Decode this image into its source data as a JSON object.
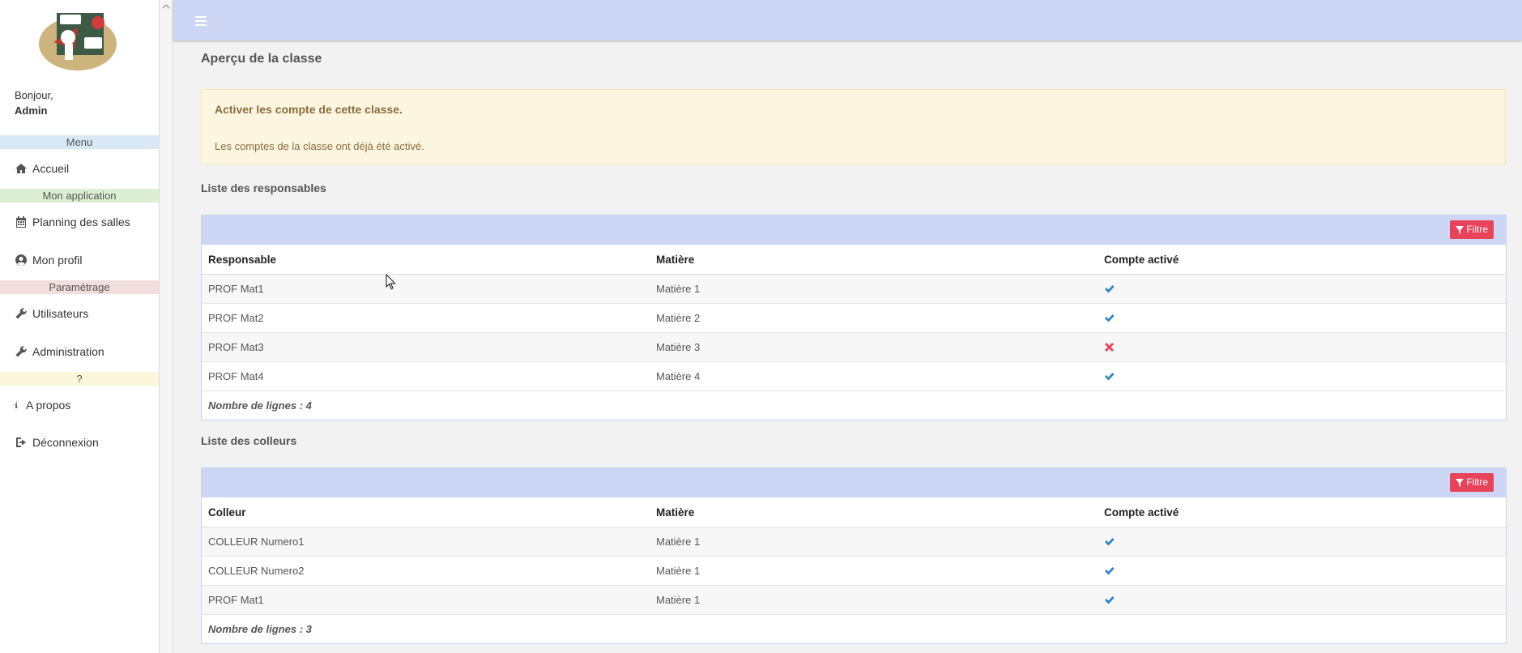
{
  "sidebar": {
    "greeting": "Bonjour,",
    "user": "Admin",
    "sections": {
      "menu": "Menu",
      "app": "Mon application",
      "settings": "Paramétrage",
      "help": "?"
    },
    "items": {
      "home": "Accueil",
      "planning": "Planning des salles",
      "profile": "Mon profil",
      "users": "Utilisateurs",
      "admin": "Administration",
      "about": "A propos",
      "logout": "Déconnexion"
    },
    "colors": {
      "menu": "#d9e8f5",
      "app": "#dcefd4",
      "settings": "#f2dede",
      "help": "#fcf6dc"
    }
  },
  "main": {
    "title": "Aperçu de la classe",
    "alert": {
      "title": "Activer les compte de cette classe.",
      "message": "Les comptes de la classe ont déjà été activé."
    },
    "responsables": {
      "heading": "Liste des responsables",
      "filter_label": "Filtre",
      "columns": [
        "Responsable",
        "Matière",
        "Compte activé"
      ],
      "rows": [
        {
          "name": "PROF Mat1",
          "subject": "Matière 1",
          "active": true
        },
        {
          "name": "PROF Mat2",
          "subject": "Matière 2",
          "active": true
        },
        {
          "name": "PROF Mat3",
          "subject": "Matière 3",
          "active": false
        },
        {
          "name": "PROF Mat4",
          "subject": "Matière 4",
          "active": true
        }
      ],
      "count": "Nombre de lignes : 4"
    },
    "colleurs": {
      "heading": "Liste des colleurs",
      "filter_label": "Filtre",
      "columns": [
        "Colleur",
        "Matière",
        "Compte activé"
      ],
      "rows": [
        {
          "name": "COLLEUR Numero1",
          "subject": "Matière 1",
          "active": true
        },
        {
          "name": "COLLEUR Numero2",
          "subject": "Matière 1",
          "active": true
        },
        {
          "name": "PROF Mat1",
          "subject": "Matière 1",
          "active": true
        }
      ],
      "count": "Nombre de lignes : 3"
    }
  },
  "icons": {
    "home": "home-icon",
    "planning": "calendar-icon",
    "profile": "user-circle-icon",
    "users": "wrench-icon",
    "admin": "wrench-icon",
    "about": "info-icon",
    "logout": "sign-out-icon",
    "check": "check-icon",
    "cross": "times-icon",
    "filter": "filter-icon"
  },
  "theme": {
    "accent": "#cdd6f4",
    "danger": "#e9435a",
    "check": "#2e84c8"
  }
}
